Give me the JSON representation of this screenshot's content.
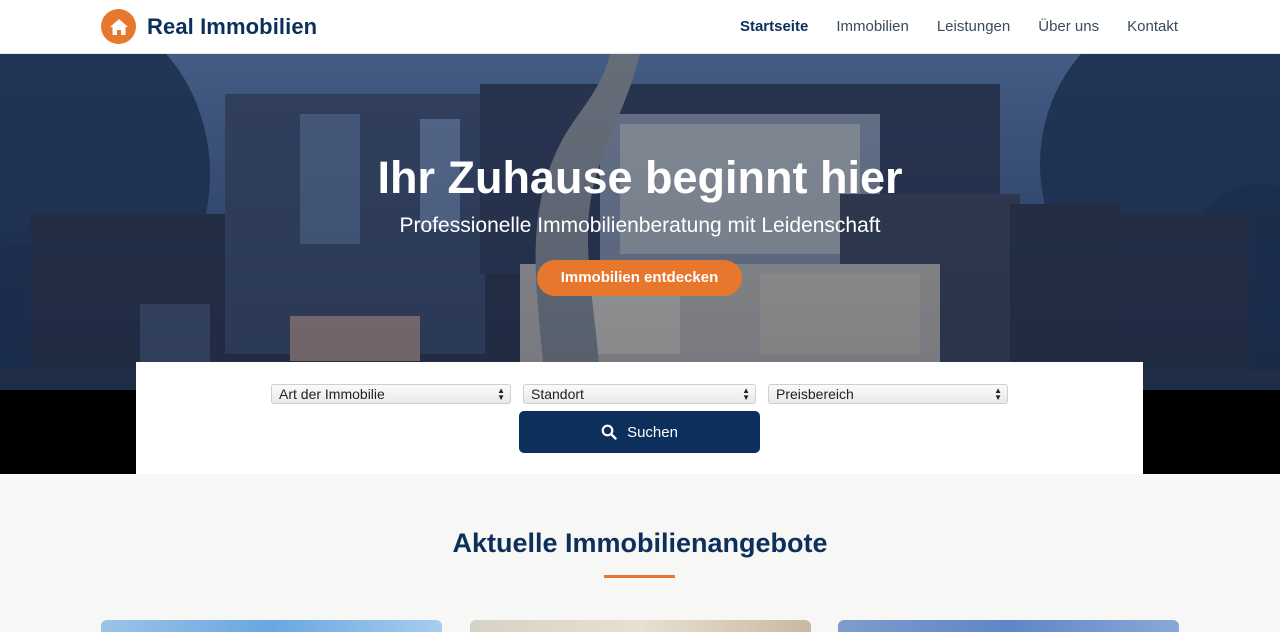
{
  "header": {
    "brand": "Real Immobilien",
    "logo_icon": "home-icon",
    "nav": [
      {
        "label": "Startseite",
        "active": true
      },
      {
        "label": "Immobilien",
        "active": false
      },
      {
        "label": "Leistungen",
        "active": false
      },
      {
        "label": "Über uns",
        "active": false
      },
      {
        "label": "Kontakt",
        "active": false
      }
    ]
  },
  "hero": {
    "title": "Ihr Zuhause beginnt hier",
    "subtitle": "Professionelle Immobilienberatung mit Leidenschaft",
    "cta_label": "Immobilien entdecken"
  },
  "search": {
    "filters": [
      {
        "selected": "Art der Immobilie"
      },
      {
        "selected": "Standort"
      },
      {
        "selected": "Preisbereich"
      }
    ],
    "button_label": "Suchen",
    "button_icon": "search-icon"
  },
  "listings": {
    "title": "Aktuelle Immobilienangebote"
  },
  "colors": {
    "brand_navy": "#0d2f5c",
    "accent_orange": "#e8772e"
  }
}
